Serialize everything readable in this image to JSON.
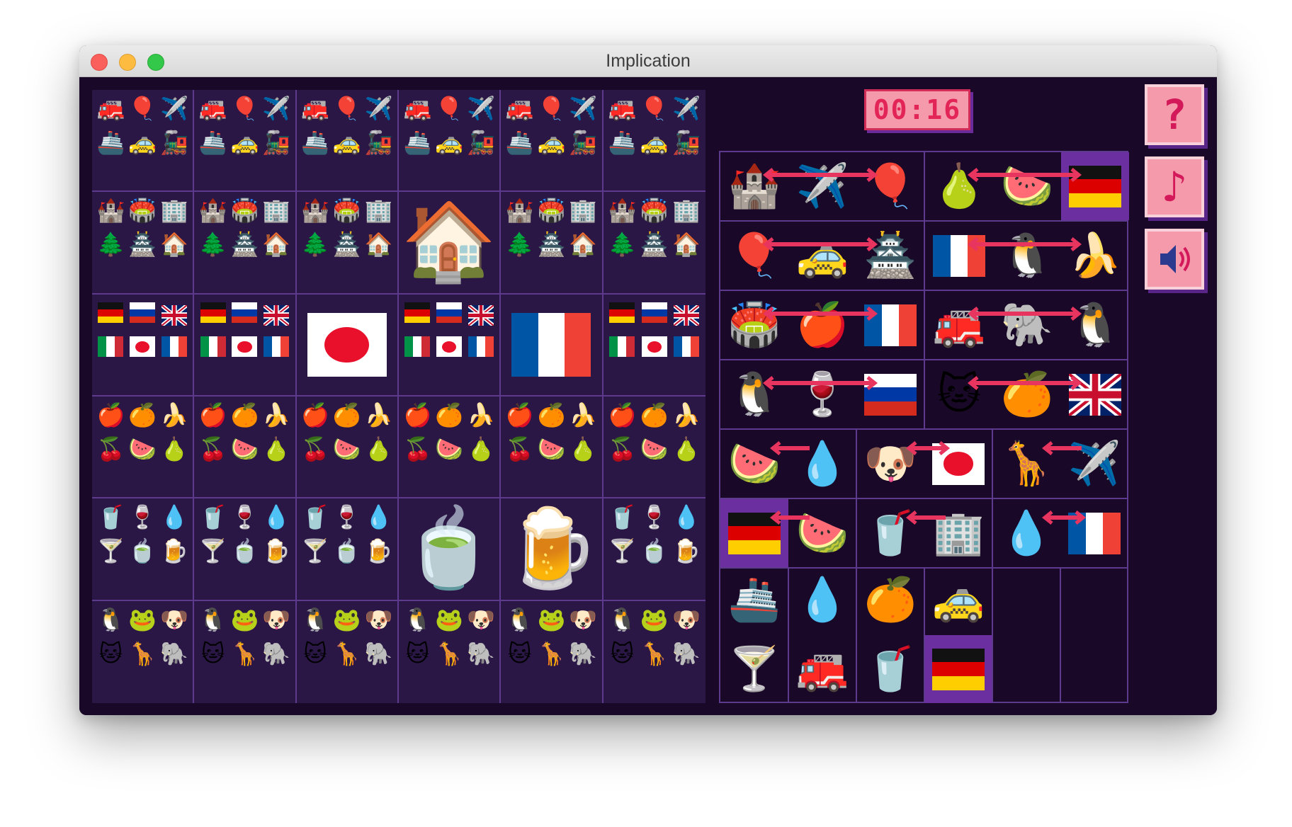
{
  "window": {
    "title": "Implication"
  },
  "timer": {
    "text": "00:16"
  },
  "buttons": {
    "help": "?",
    "music": "♪",
    "sound": "sound-icon"
  },
  "colors": {
    "background": "#1a0828",
    "panel": "#2a1746",
    "grid": "#5e3a8e",
    "accent_pink": "#f59aaa",
    "arrow": "#e8355f",
    "highlight": "#6b2fa0"
  },
  "catalog": {
    "rows": [
      {
        "name": "vehicles",
        "items": [
          "🚒",
          "🎈",
          "✈️",
          "🚢",
          "🚕",
          "🚂"
        ],
        "resolved": []
      },
      {
        "name": "buildings",
        "items": [
          "🏰",
          "🏟️",
          "🏢",
          "🌲",
          "🏯",
          "🏠"
        ],
        "resolved": [
          {
            "col": 3,
            "item": "🏠"
          }
        ]
      },
      {
        "name": "flags",
        "items": [
          "de",
          "ru",
          "uk",
          "it",
          "jp",
          "fr"
        ],
        "resolved": [
          {
            "col": 2,
            "item": "jp"
          },
          {
            "col": 4,
            "item": "fr"
          }
        ]
      },
      {
        "name": "fruits",
        "items": [
          "🍎",
          "🍊",
          "🍌",
          "🍒",
          "🍉",
          "🍐"
        ],
        "resolved": []
      },
      {
        "name": "drinks",
        "items": [
          "🥤",
          "🍷",
          "💧",
          "🍸",
          "🍵",
          "🍺"
        ],
        "resolved": [
          {
            "col": 3,
            "item": "🍵"
          },
          {
            "col": 4,
            "item": "🍺"
          }
        ]
      },
      {
        "name": "animals",
        "items": [
          "🐧",
          "🐸",
          "🐶",
          "🐱",
          "🦒",
          "🐘"
        ],
        "resolved": []
      }
    ]
  },
  "board": {
    "pairs": [
      {
        "row": 0,
        "cells": [
          "🏰",
          "✈️",
          "🎈"
        ],
        "cells2": [
          "🍐",
          "🍉",
          "de"
        ]
      },
      {
        "row": 1,
        "cells": [
          "🎈",
          "🚕",
          "🏯"
        ],
        "cells2": [
          "fr",
          "🐧",
          "🍌"
        ]
      },
      {
        "row": 2,
        "cells": [
          "🏟️",
          "🍎",
          "fr"
        ],
        "cells2": [
          "🚒",
          "🐘",
          "🐧"
        ]
      },
      {
        "row": 3,
        "cells": [
          "🐧",
          "🍷",
          "ru"
        ],
        "cells2": [
          "🐱",
          "🍊",
          "uk"
        ]
      },
      {
        "row": 4,
        "cells": [
          "🍉",
          "💧",
          "🐶",
          "jp",
          "🦒",
          "✈️"
        ]
      },
      {
        "row": 5,
        "cells": [
          "de",
          "🍉",
          "🥤",
          "🏢",
          "💧",
          "fr"
        ]
      },
      {
        "row": 6,
        "cells": [
          "🚢",
          "💧",
          "🍊",
          "🚕"
        ]
      },
      {
        "row": 7,
        "cells": [
          "🍸",
          "🚒",
          "🥤",
          "de"
        ]
      }
    ]
  }
}
